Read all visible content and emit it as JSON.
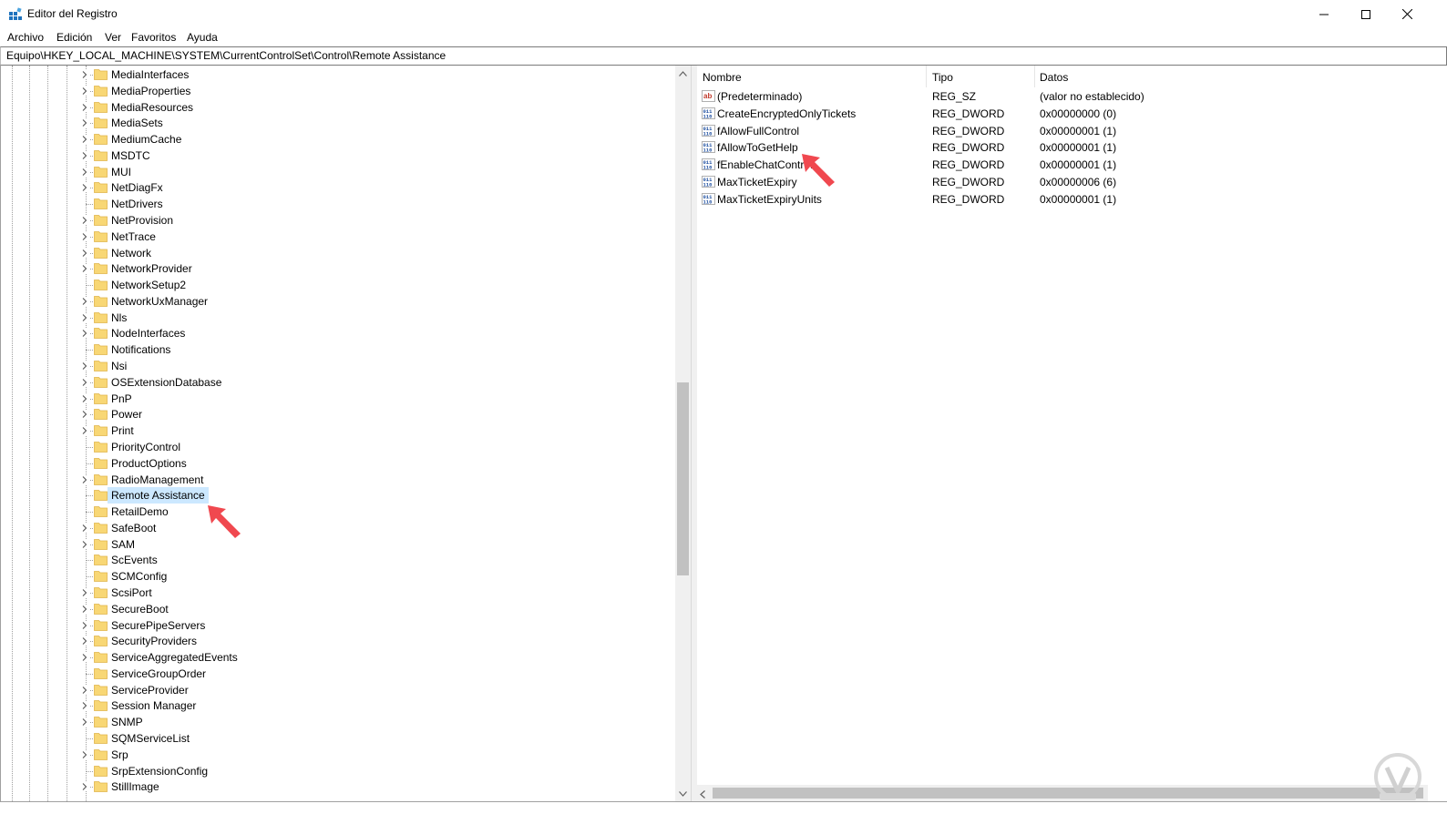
{
  "window": {
    "title": "Editor del Registro",
    "controls": {
      "minimize": "minimize-icon",
      "maximize": "maximize-icon",
      "close": "close-icon"
    }
  },
  "menu": [
    "Archivo",
    "Edición",
    "Ver",
    "Favoritos",
    "Ayuda"
  ],
  "address": "Equipo\\HKEY_LOCAL_MACHINE\\SYSTEM\\CurrentControlSet\\Control\\Remote Assistance",
  "tree": {
    "items": [
      {
        "label": "MediaInterfaces",
        "expandable": true
      },
      {
        "label": "MediaProperties",
        "expandable": true
      },
      {
        "label": "MediaResources",
        "expandable": true
      },
      {
        "label": "MediaSets",
        "expandable": true
      },
      {
        "label": "MediumCache",
        "expandable": true
      },
      {
        "label": "MSDTC",
        "expandable": true
      },
      {
        "label": "MUI",
        "expandable": true
      },
      {
        "label": "NetDiagFx",
        "expandable": true
      },
      {
        "label": "NetDrivers",
        "expandable": false
      },
      {
        "label": "NetProvision",
        "expandable": true
      },
      {
        "label": "NetTrace",
        "expandable": true
      },
      {
        "label": "Network",
        "expandable": true
      },
      {
        "label": "NetworkProvider",
        "expandable": true
      },
      {
        "label": "NetworkSetup2",
        "expandable": false
      },
      {
        "label": "NetworkUxManager",
        "expandable": true
      },
      {
        "label": "Nls",
        "expandable": true
      },
      {
        "label": "NodeInterfaces",
        "expandable": true
      },
      {
        "label": "Notifications",
        "expandable": false
      },
      {
        "label": "Nsi",
        "expandable": true
      },
      {
        "label": "OSExtensionDatabase",
        "expandable": true
      },
      {
        "label": "PnP",
        "expandable": true
      },
      {
        "label": "Power",
        "expandable": true
      },
      {
        "label": "Print",
        "expandable": true
      },
      {
        "label": "PriorityControl",
        "expandable": false
      },
      {
        "label": "ProductOptions",
        "expandable": false
      },
      {
        "label": "RadioManagement",
        "expandable": true
      },
      {
        "label": "Remote Assistance",
        "expandable": false,
        "selected": true
      },
      {
        "label": "RetailDemo",
        "expandable": false
      },
      {
        "label": "SafeBoot",
        "expandable": true
      },
      {
        "label": "SAM",
        "expandable": true
      },
      {
        "label": "ScEvents",
        "expandable": false
      },
      {
        "label": "SCMConfig",
        "expandable": false
      },
      {
        "label": "ScsiPort",
        "expandable": true
      },
      {
        "label": "SecureBoot",
        "expandable": true
      },
      {
        "label": "SecurePipeServers",
        "expandable": true
      },
      {
        "label": "SecurityProviders",
        "expandable": true
      },
      {
        "label": "ServiceAggregatedEvents",
        "expandable": true
      },
      {
        "label": "ServiceGroupOrder",
        "expandable": false
      },
      {
        "label": "ServiceProvider",
        "expandable": true
      },
      {
        "label": "Session Manager",
        "expandable": true
      },
      {
        "label": "SNMP",
        "expandable": true
      },
      {
        "label": "SQMServiceList",
        "expandable": false
      },
      {
        "label": "Srp",
        "expandable": true
      },
      {
        "label": "SrpExtensionConfig",
        "expandable": false
      },
      {
        "label": "StillImage",
        "expandable": true
      }
    ]
  },
  "list": {
    "headers": {
      "name": "Nombre",
      "type": "Tipo",
      "data": "Datos"
    },
    "rows": [
      {
        "icon": "string-value-icon",
        "name": "(Predeterminado)",
        "type": "REG_SZ",
        "data": "(valor no establecido)"
      },
      {
        "icon": "binary-value-icon",
        "name": "CreateEncryptedOnlyTickets",
        "type": "REG_DWORD",
        "data": "0x00000000 (0)"
      },
      {
        "icon": "binary-value-icon",
        "name": "fAllowFullControl",
        "type": "REG_DWORD",
        "data": "0x00000001 (1)"
      },
      {
        "icon": "binary-value-icon",
        "name": "fAllowToGetHelp",
        "type": "REG_DWORD",
        "data": "0x00000001 (1)"
      },
      {
        "icon": "binary-value-icon",
        "name": "fEnableChatControl",
        "type": "REG_DWORD",
        "data": "0x00000001 (1)"
      },
      {
        "icon": "binary-value-icon",
        "name": "MaxTicketExpiry",
        "type": "REG_DWORD",
        "data": "0x00000006 (6)"
      },
      {
        "icon": "binary-value-icon",
        "name": "MaxTicketExpiryUnits",
        "type": "REG_DWORD",
        "data": "0x00000001 (1)"
      }
    ]
  },
  "colors": {
    "selection": "#cce8ff",
    "folder": "#f8d775",
    "annotation_arrow": "#f0484f"
  }
}
